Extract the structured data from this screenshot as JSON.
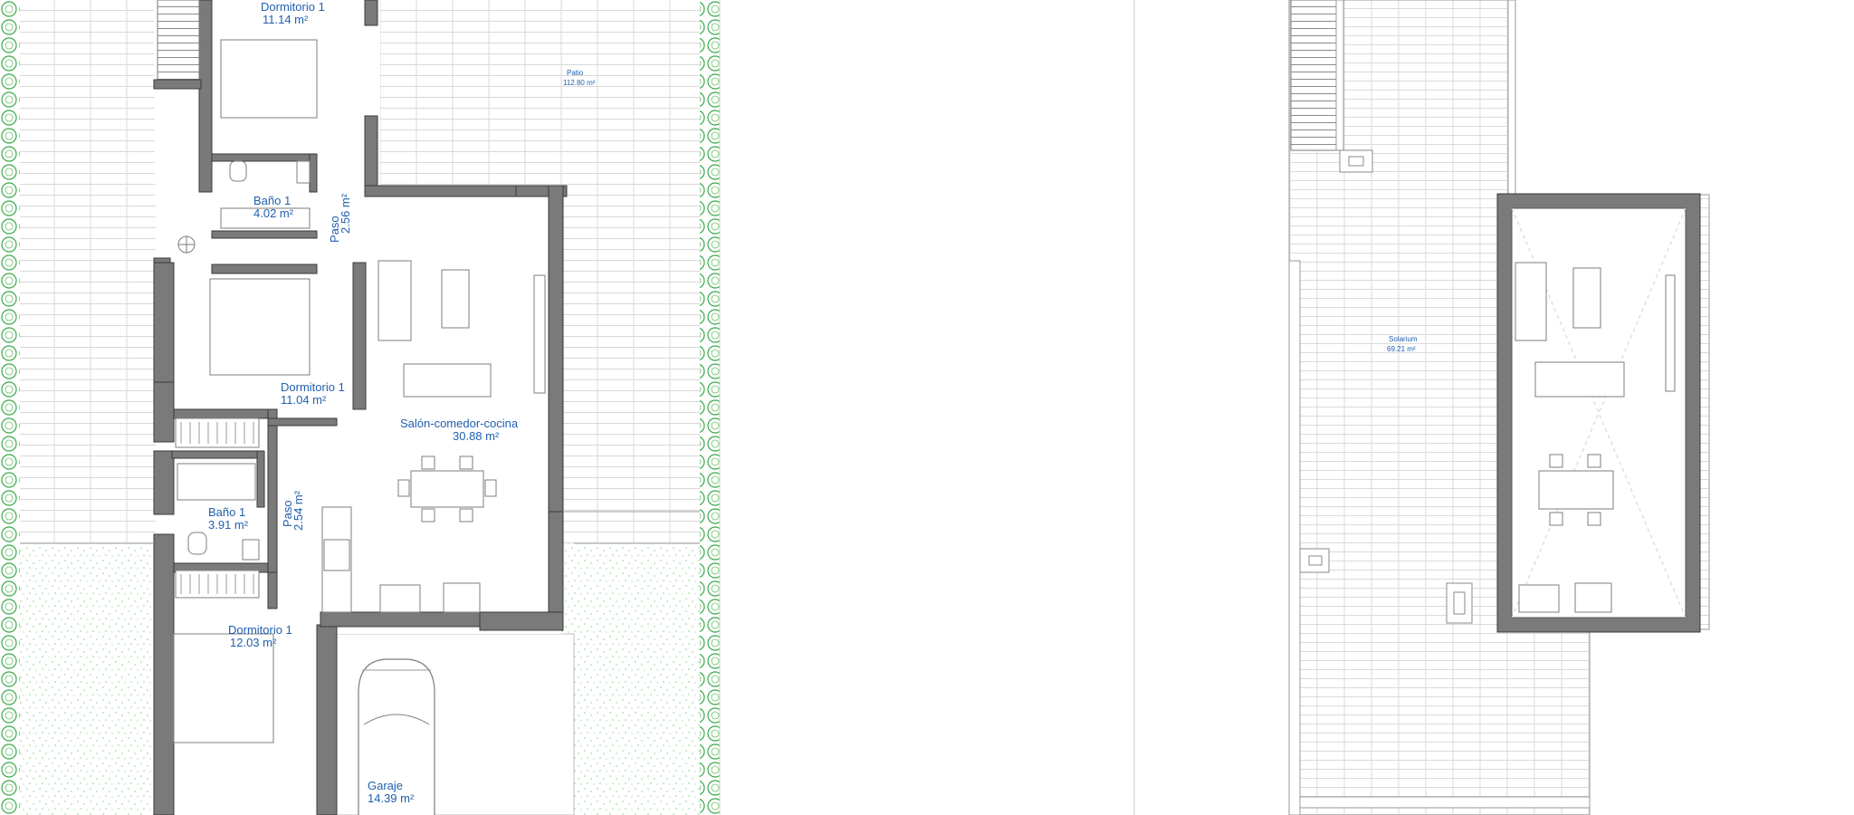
{
  "ground_floor": {
    "rooms": [
      {
        "id": "dormitorio-top",
        "name": "Dormitorio 1",
        "area": "11.14 m²"
      },
      {
        "id": "bano-top",
        "name": "Baño 1",
        "area": "4.02 m²"
      },
      {
        "id": "paso-top",
        "name": "Paso",
        "area": "2.56 m²"
      },
      {
        "id": "dormitorio-mid",
        "name": "Dormitorio 1",
        "area": "11.04 m²"
      },
      {
        "id": "salon",
        "name": "Salón-comedor-cocina",
        "area": "30.88 m²"
      },
      {
        "id": "paso-mid",
        "name": "Paso",
        "area": "2.54 m²"
      },
      {
        "id": "bano-mid",
        "name": "Baño 1",
        "area": "3.91 m²"
      },
      {
        "id": "dormitorio-bottom",
        "name": "Dormitorio 1",
        "area": "12.03 m²"
      },
      {
        "id": "garaje",
        "name": "Garaje",
        "area": "14.39 m²"
      },
      {
        "id": "patio",
        "name": "Patio",
        "area": "112.80 m²"
      }
    ]
  },
  "roof_floor": {
    "rooms": [
      {
        "id": "solarium",
        "name": "Solarium",
        "area": "69.21 m²"
      }
    ]
  },
  "colors": {
    "label": "#1f5fae",
    "wall": "#7a7a7a",
    "hedge": "#3aa84a",
    "tile_line": "#d4d4d4"
  }
}
